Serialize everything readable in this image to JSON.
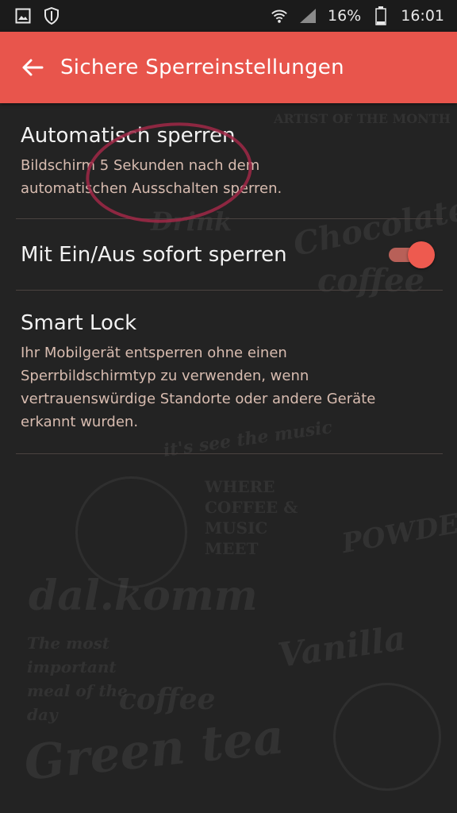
{
  "status_bar": {
    "battery": "16%",
    "time": "16:01",
    "icons": [
      "gallery-icon",
      "shield-icon",
      "wifi-icon",
      "signal-icon",
      "battery-icon"
    ]
  },
  "app_bar": {
    "title": "Sichere Sperreinstellungen",
    "back_icon": "arrow-left-icon",
    "color": "#e8554c"
  },
  "settings": {
    "auto_lock": {
      "title": "Automatisch sperren",
      "subtitle": "Bildschirm 5 Sekunden nach dem automatischen Ausschalten sperren."
    },
    "power_lock": {
      "title": "Mit Ein/Aus sofort sperren",
      "enabled": true
    },
    "smart_lock": {
      "title": "Smart Lock",
      "subtitle": "Ihr Mobilgerät entsperren ohne einen Sperrbildschirmtyp zu verwenden, wenn vertrauenswürdige Standorte oder andere Geräte erkannt wurden."
    }
  },
  "wallpaper": {
    "lines": [
      "Chocolate",
      "coffee",
      "Drink",
      "WHERE COFFEE & MUSIC MEET",
      "POWDER",
      "dal.komm",
      "The most important meal of the day",
      "Vanilla",
      "coffee",
      "Green tea",
      "ARTIST OF THE MONTH",
      "it's see the music"
    ]
  }
}
